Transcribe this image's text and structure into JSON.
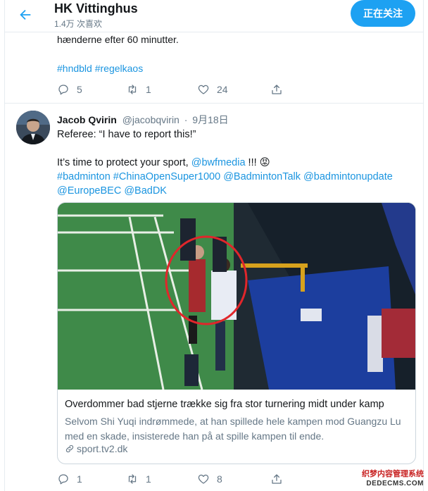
{
  "header": {
    "title": "HK Vittinghus",
    "subtitle": "1.4万 次喜欢",
    "follow_label": "正在关注"
  },
  "tweet1": {
    "text_tail": "hænderne efter 60 minutter.",
    "hashtags": "#hndbld #regelkaos",
    "reply_count": "5",
    "retweet_count": "1",
    "like_count": "24"
  },
  "tweet2": {
    "author_name": "Jacob Qvirin",
    "handle": "@jacobqvirin",
    "separator": "·",
    "date": "9月18日",
    "line1": "Referee: “I have to report this!”",
    "line2_prefix": "It’s time to protect your sport, ",
    "mention_bwf": "@bwfmedia",
    "line2_suffix": " !!! 😡",
    "line3": "#badminton #ChinaOpenSuper1000 @BadmintonTalk @badmintonupdate",
    "line4": "@EuropeBEC @BadDK",
    "card": {
      "title": "Overdommer bad stjerne trække sig fra stor turnering midt under kamp",
      "description": "Selvom Shi Yuqi indrømmede, at han spillede hele kampen mod Guangzu Lu med en skade, insisterede han på at spille kampen til ende.",
      "domain": "sport.tv2.dk"
    },
    "reply_count": "1",
    "retweet_count": "1",
    "like_count": "8"
  },
  "watermark": {
    "line1": "织梦内容管理系统",
    "line2": "DEDECMS.COM"
  },
  "icons": {
    "back": "back-arrow-icon",
    "reply": "reply-icon",
    "retweet": "retweet-icon",
    "like": "heart-icon",
    "share": "share-icon",
    "link": "link-icon"
  },
  "colors": {
    "accent": "#1da1f2",
    "link": "#1b95e0",
    "muted": "#657786"
  }
}
